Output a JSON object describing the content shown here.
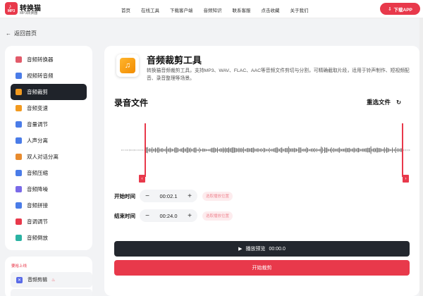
{
  "header": {
    "logo_text": "MP3",
    "brand_name": "转换猫",
    "brand_sub": "MP3转换器",
    "nav": [
      "首页",
      "在线工具",
      "下载客户端",
      "音频知识",
      "联系客服",
      "点击收藏",
      "关于我们"
    ],
    "download_label": "下载APP"
  },
  "back_label": "返回首页",
  "sidebar": {
    "items": [
      {
        "label": "音频转换器",
        "color": "#e25b6a",
        "icon": "audio-convert-icon"
      },
      {
        "label": "视频转音频",
        "color": "#4a7ce8",
        "icon": "video-to-audio-icon"
      },
      {
        "label": "音频裁剪",
        "color": "#f29a1f",
        "icon": "audio-cut-icon",
        "active": true
      },
      {
        "label": "音频变速",
        "color": "#f29a1f",
        "icon": "speed-icon"
      },
      {
        "label": "音量调节",
        "color": "#4a7ce8",
        "icon": "volume-icon"
      },
      {
        "label": "人声分离",
        "color": "#4a7ce8",
        "icon": "voice-separate-icon"
      },
      {
        "label": "双人对话分离",
        "color": "#e88b2e",
        "icon": "dialogue-icon"
      },
      {
        "label": "音频压缩",
        "color": "#4a7ce8",
        "icon": "compress-icon"
      },
      {
        "label": "音频降噪",
        "color": "#7a6ae8",
        "icon": "denoise-icon"
      },
      {
        "label": "音频拼接",
        "color": "#4a7ce8",
        "icon": "merge-icon"
      },
      {
        "label": "音调调节",
        "color": "#e8394b",
        "icon": "pitch-icon"
      },
      {
        "label": "音频倒放",
        "color": "#2bb3a3",
        "icon": "reverse-icon"
      }
    ],
    "section2_title": "要裕上线",
    "section2_item": "音频剪辑"
  },
  "main": {
    "tool_title": "音频裁剪工具",
    "tool_desc": "转换猫音频裁剪工具，支持MP3、WAV、FLAC、AAC等音频文件剪切与分割，可精确截取片段，适用于铃声制作、短视频配音、录音整理等场景。",
    "section_title": "录音文件",
    "reselect_label": "重选文件",
    "start_label": "开始时间",
    "start_value": "00:02.1",
    "end_label": "结束时间",
    "end_value": "00:24.0",
    "pick_label": "选取播放位置",
    "preview_label": "播放预览",
    "preview_time": "00:00.0",
    "cut_label": "开始裁剪"
  },
  "colors": {
    "accent": "#e8394b",
    "dark": "#23272e"
  }
}
